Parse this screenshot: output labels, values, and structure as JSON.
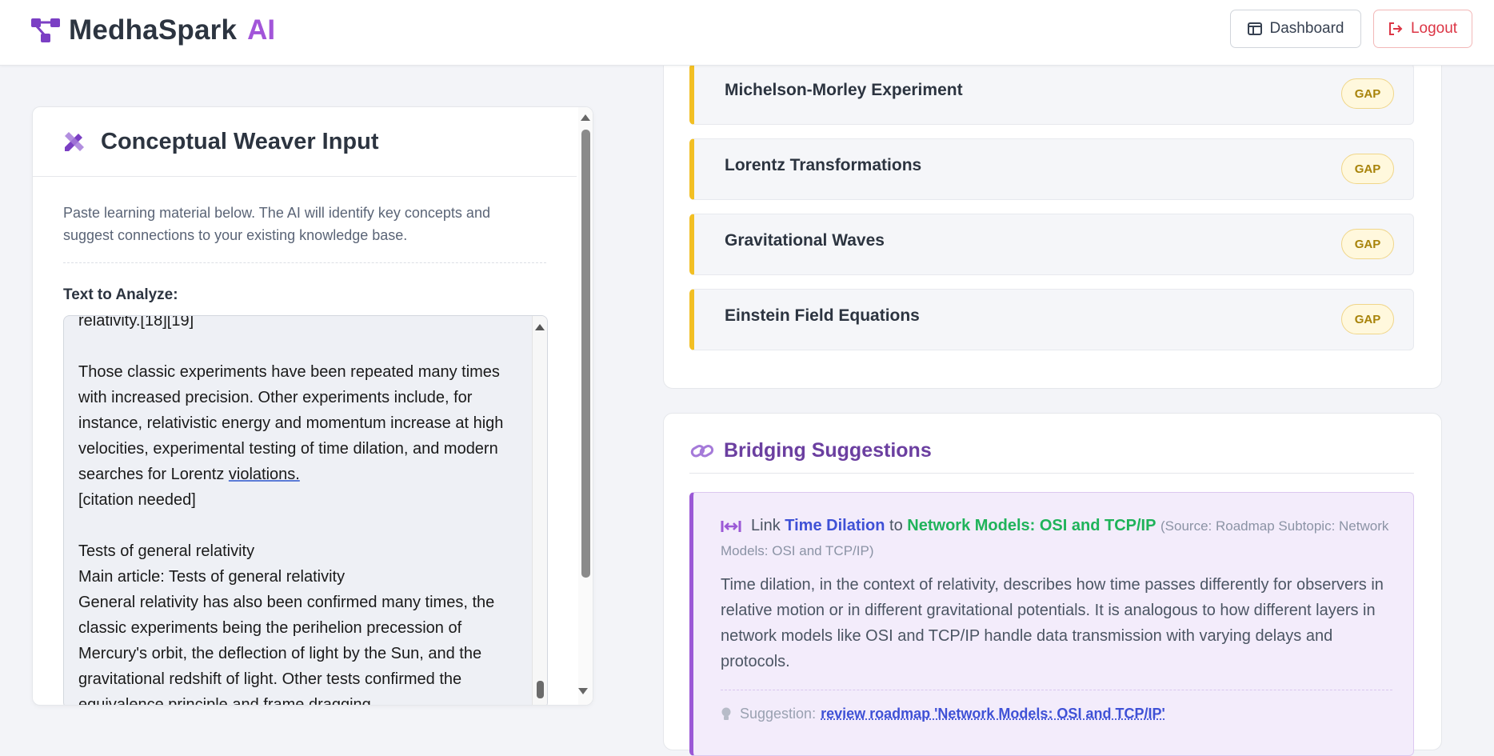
{
  "header": {
    "brand_name": "MedhaSpark",
    "brand_ai": "AI",
    "dashboard_label": "Dashboard",
    "logout_label": "Logout"
  },
  "weaver": {
    "title": "Conceptual Weaver Input",
    "description": "Paste learning material below. The AI will identify key concepts and suggest connections to your existing knowledge base.",
    "text_label": "Text to Analyze:",
    "text_before_underline": "relativity.[18][19]\n\nThose classic experiments have been repeated many times with increased precision. Other experiments include, for instance, relativistic energy and momentum increase at high velocities, experimental testing of time dilation, and modern searches for Lorentz ",
    "text_underlined": "violations.",
    "text_after_underline": "\n[citation needed]\n\nTests of general relativity\nMain article: Tests of general relativity\nGeneral relativity has also been confirmed many times, the classic experiments being the perihelion precession of Mercury's orbit, the deflection of light by the Sun, and the gravitational redshift of light. Other tests confirmed the equivalence principle and frame dragging."
  },
  "gaps": {
    "items": [
      {
        "name": "Michelson-Morley Experiment",
        "badge": "GAP"
      },
      {
        "name": "Lorentz Transformations",
        "badge": "GAP"
      },
      {
        "name": "Gravitational Waves",
        "badge": "GAP"
      },
      {
        "name": "Einstein Field Equations",
        "badge": "GAP"
      }
    ],
    "accent_color": "#f2bf24"
  },
  "bridging": {
    "title": "Bridging Suggestions",
    "suggestion": {
      "link_word": "Link",
      "from": "Time Dilation",
      "to_word": "to",
      "to": "Network Models: OSI and TCP/IP",
      "source": "(Source: Roadmap Subtopic: Network Models: OSI and TCP/IP)",
      "body": "Time dilation, in the context of relativity, describes how time passes differently for observers in relative motion or in different gravitational potentials. It is analogous to how different layers in network models like OSI and TCP/IP handle data transmission with varying delays and protocols.",
      "tip_prefix": "Suggestion:",
      "tip_link": "review roadmap 'Network Models: OSI and TCP/IP'"
    }
  },
  "colors": {
    "brand_purple": "#a255d9",
    "logout_red": "#dc3545",
    "link_blue": "#3f51d6",
    "link_green": "#1fb35a"
  }
}
